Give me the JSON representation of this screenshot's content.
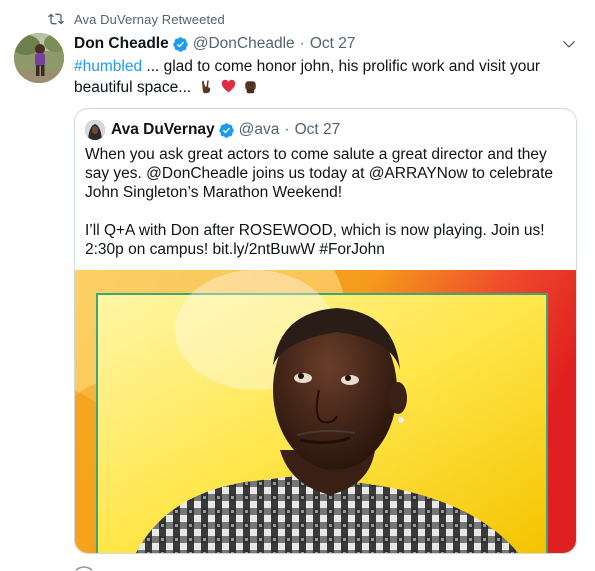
{
  "retweet": {
    "icon": "retweet-icon",
    "label": "Ava DuVernay Retweeted"
  },
  "tweet": {
    "author": {
      "display_name": "Don Cheadle",
      "handle": "@DonCheadle",
      "verified": true,
      "avatar": "avatar-child-photo"
    },
    "separator": "·",
    "date": "Oct 27",
    "text_parts": {
      "hashtag": "#humbled",
      "body": " ... glad to come honor john, his prolific work and visit your beautiful space..."
    },
    "emojis": [
      "victory-hand-emoji",
      "red-heart-emoji",
      "raised-fist-emoji"
    ],
    "menu_icon": "chevron-down-icon"
  },
  "quote": {
    "author": {
      "display_name": "Ava DuVernay",
      "handle": "@ava",
      "verified": true,
      "avatar": "avatar-ava-photo"
    },
    "separator": "·",
    "date": "Oct 27",
    "text": "When you ask great actors to come salute a great director and they say yes. @DonCheadle joins us today at @ARRAYNow to celebrate John Singleton’s Marathon Weekend!\n\nI’ll Q+A with Don after ROSEWOOD, which is now playing. Join us! 2:30p on campus! bit.ly/2ntBuwW #ForJohn",
    "media": "photo-don-cheadle-portrait"
  },
  "colors": {
    "link": "#1d9bf0",
    "secondary_text": "#536471",
    "border": "#cfd9de",
    "verified": "#1d9bf0"
  }
}
